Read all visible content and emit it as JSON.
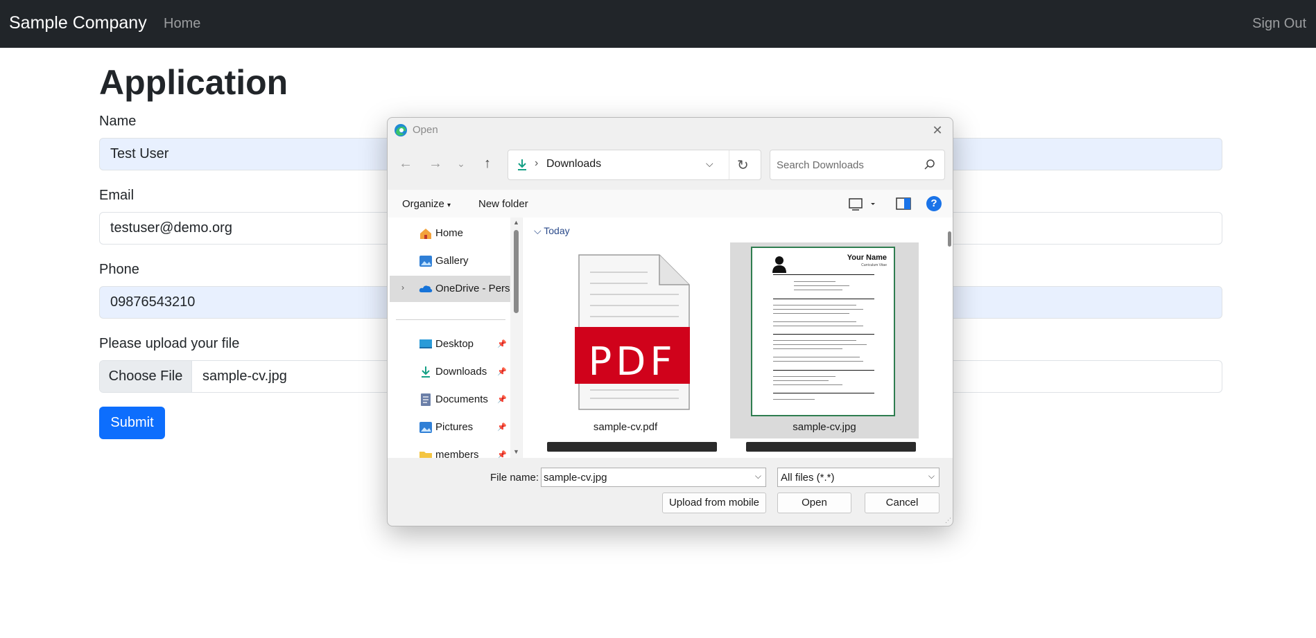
{
  "navbar": {
    "brand": "Sample Company",
    "home": "Home",
    "sign_out": "Sign Out"
  },
  "form": {
    "title": "Application",
    "name_label": "Name",
    "name_value": "Test User",
    "email_label": "Email",
    "email_value": "testuser@demo.org",
    "phone_label": "Phone",
    "phone_value": "09876543210",
    "file_label": "Please upload your file",
    "choose_file": "Choose File",
    "file_value": "sample-cv.jpg",
    "submit": "Submit"
  },
  "dialog": {
    "title": "Open",
    "address": "Downloads",
    "search_placeholder": "Search Downloads",
    "organize": "Organize",
    "new_folder": "New folder",
    "help": "?",
    "nav_items": [
      {
        "label": "Home",
        "icon": "home-icon"
      },
      {
        "label": "Gallery",
        "icon": "gallery-icon"
      },
      {
        "label": "OneDrive - Personal",
        "icon": "onedrive-icon"
      },
      {
        "label": "Desktop",
        "icon": "desktop-icon"
      },
      {
        "label": "Downloads",
        "icon": "downloads-icon"
      },
      {
        "label": "Documents",
        "icon": "documents-icon"
      },
      {
        "label": "Pictures",
        "icon": "pictures-icon"
      },
      {
        "label": "members",
        "icon": "folder-icon"
      }
    ],
    "group": "Today",
    "files": [
      {
        "name": "sample-cv.pdf",
        "badge": "PDF"
      },
      {
        "name": "sample-cv.jpg",
        "preview_title": "Your Name",
        "preview_subtitle": "Curriculum Vitae"
      }
    ],
    "file_name_label": "File name:",
    "file_name_value": "sample-cv.jpg",
    "file_filter": "All files (*.*)",
    "upload_mobile": "Upload from mobile",
    "open": "Open",
    "cancel": "Cancel"
  },
  "colors": {
    "navbar_bg": "#212529",
    "primary": "#0d6efd",
    "autofill_bg": "#e8f0fe",
    "pdf_red": "#d0021b"
  }
}
